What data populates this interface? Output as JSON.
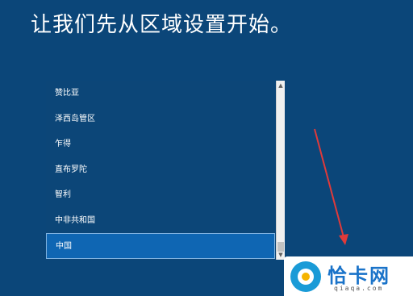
{
  "page": {
    "title": "让我们先从区域设置开始。"
  },
  "region_list": {
    "items": [
      {
        "label": "赞比亚",
        "selected": false
      },
      {
        "label": "泽西岛管区",
        "selected": false
      },
      {
        "label": "乍得",
        "selected": false
      },
      {
        "label": "直布罗陀",
        "selected": false
      },
      {
        "label": "智利",
        "selected": false
      },
      {
        "label": "中非共和国",
        "selected": false
      },
      {
        "label": "中国",
        "selected": true
      }
    ]
  },
  "scrollbar": {
    "up_icon": "chevron-up-icon",
    "down_icon": "chevron-down-icon"
  },
  "watermark": {
    "title": "恰卡网",
    "domain": "qiaqa.com"
  },
  "colors": {
    "background": "#0b4679",
    "selected_item": "#0f66b3",
    "annotation_arrow": "#e03a3a",
    "watermark_brand": "#1a73c9"
  }
}
